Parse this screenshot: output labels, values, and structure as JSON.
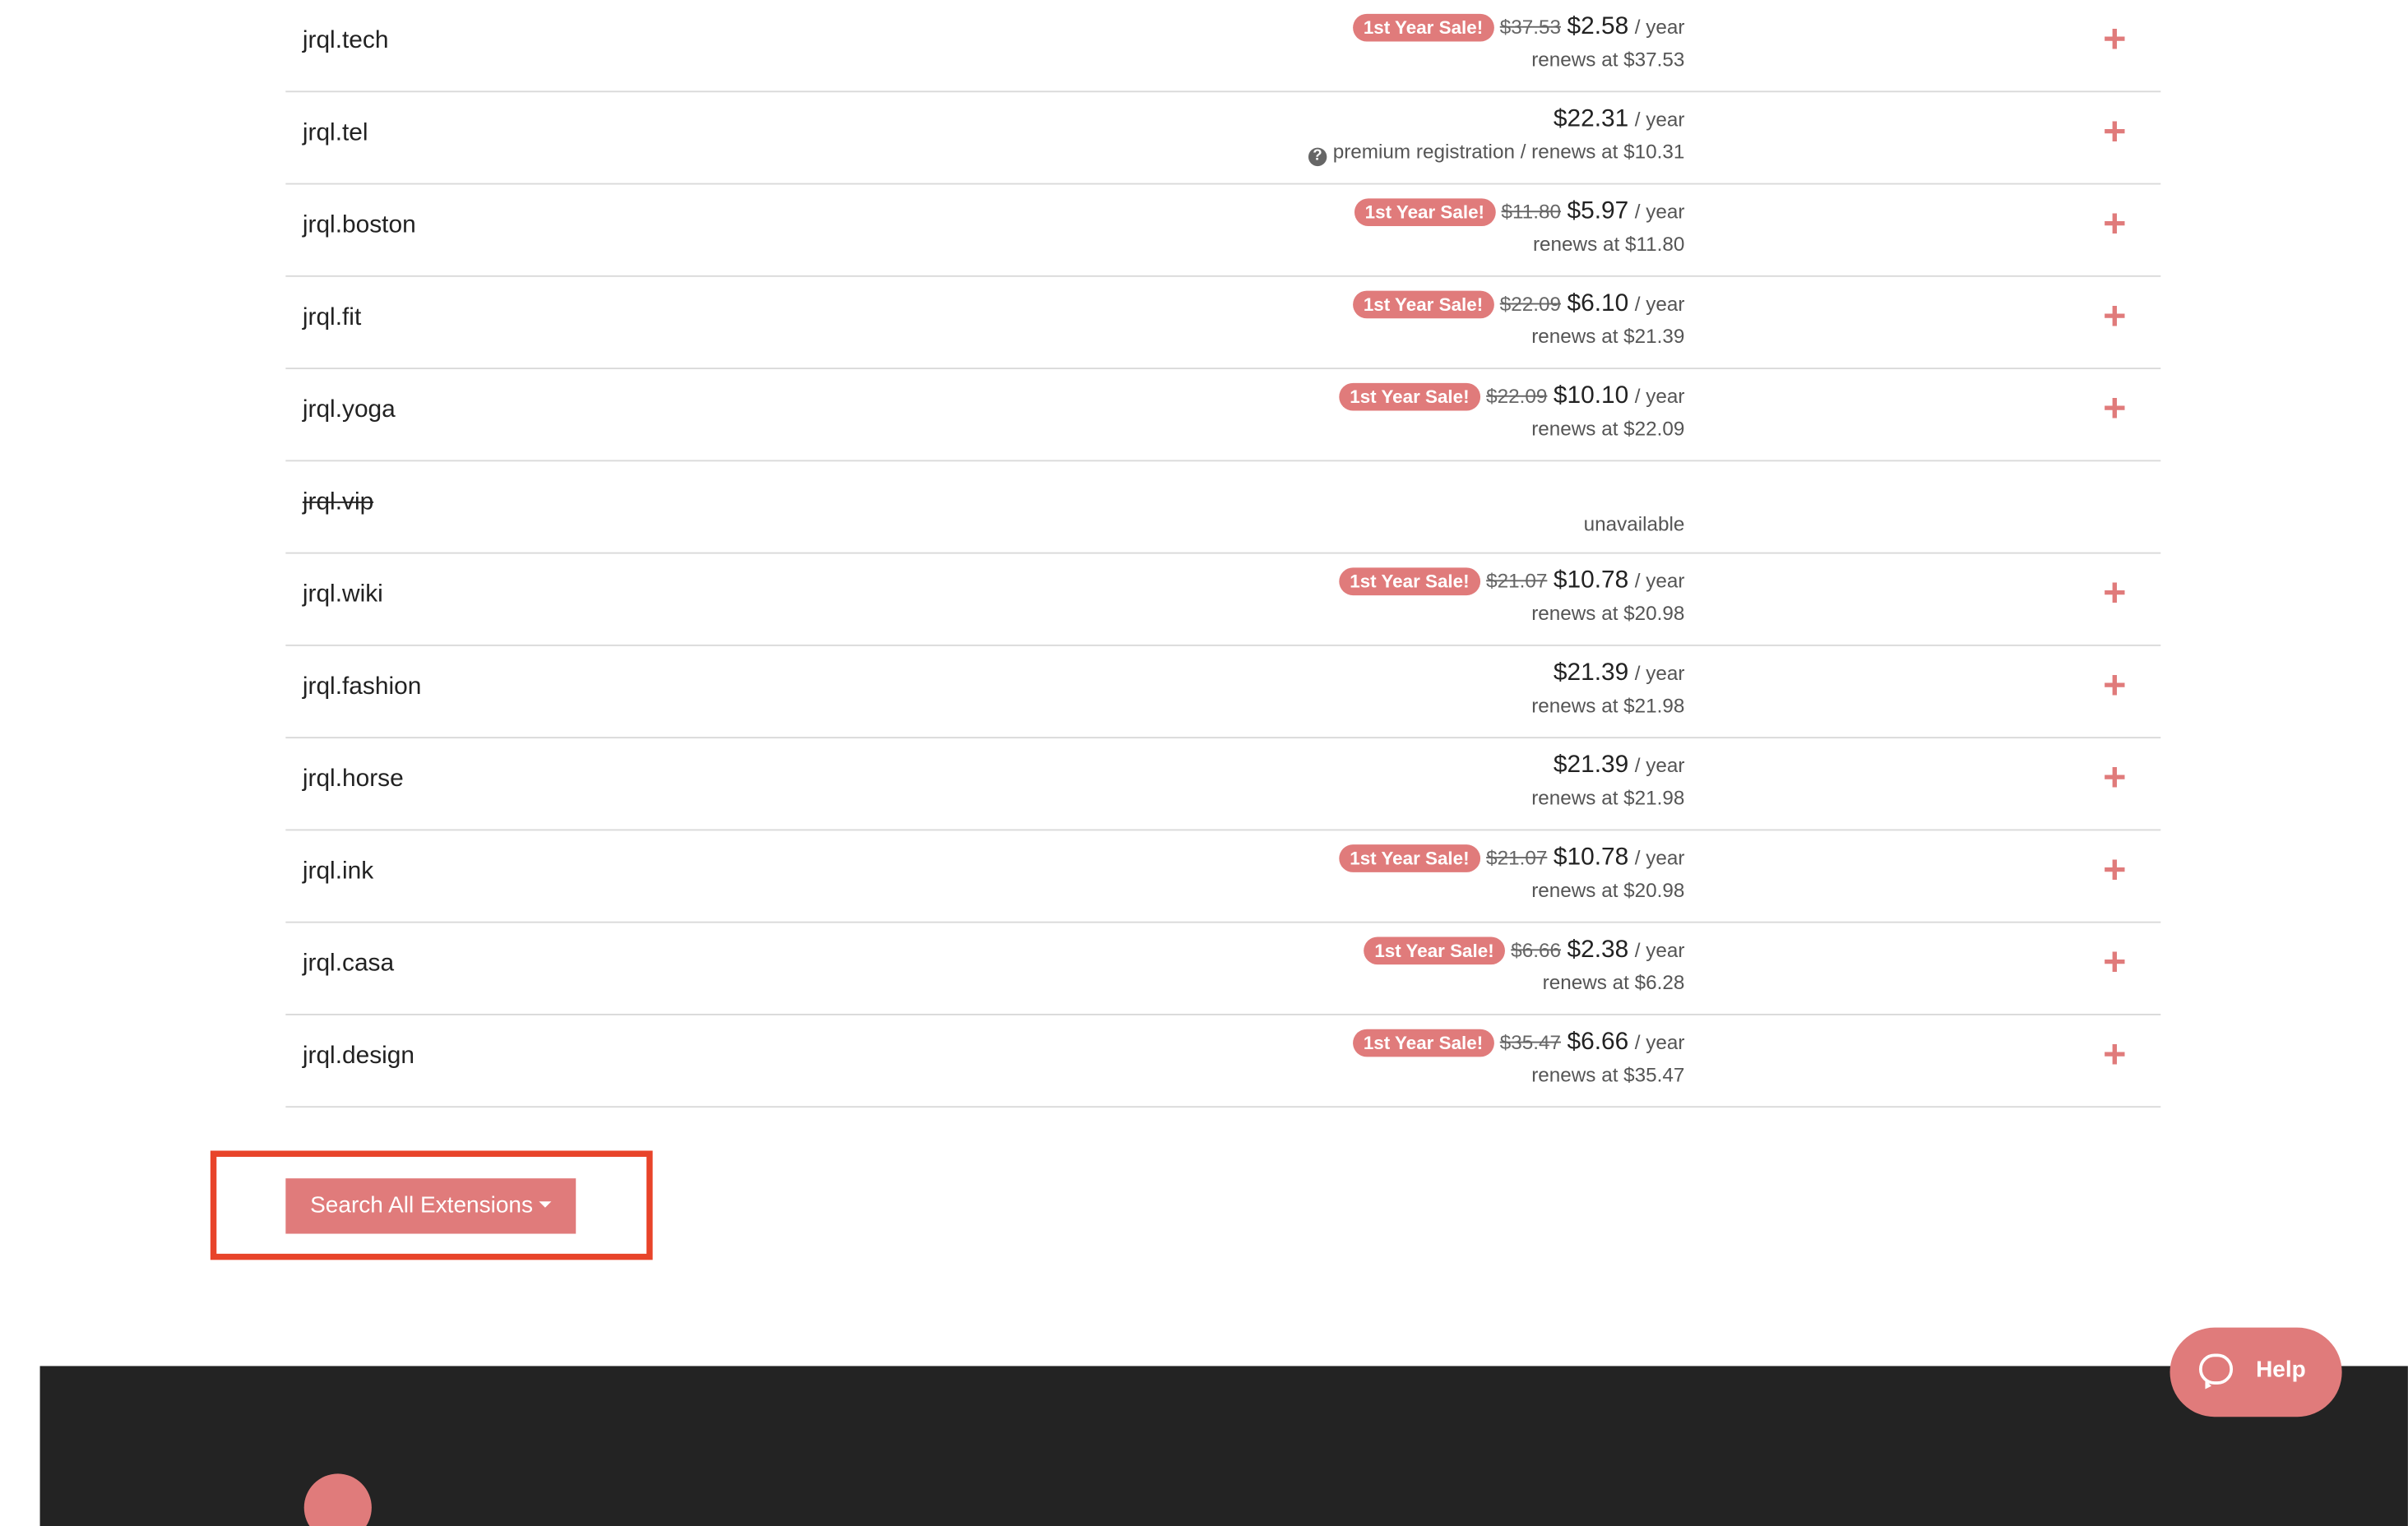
{
  "domains": [
    {
      "name": "jrql.tech",
      "badge": "1st Year Sale!",
      "old": "$37.53",
      "price": "$2.58",
      "per": "/ year",
      "sub": "renews at $37.53"
    },
    {
      "name": "jrql.tel",
      "badge": "",
      "old": "",
      "price": "$22.31",
      "per": "/ year",
      "sub": "premium registration / renews at $10.31",
      "info_icon": "question-circle-icon"
    },
    {
      "name": "jrql.boston",
      "badge": "1st Year Sale!",
      "old": "$11.80",
      "price": "$5.97",
      "per": "/ year",
      "sub": "renews at $11.80"
    },
    {
      "name": "jrql.fit",
      "badge": "1st Year Sale!",
      "old": "$22.09",
      "price": "$6.10",
      "per": "/ year",
      "sub": "renews at $21.39"
    },
    {
      "name": "jrql.yoga",
      "badge": "1st Year Sale!",
      "old": "$22.09",
      "price": "$10.10",
      "per": "/ year",
      "sub": "renews at $22.09"
    },
    {
      "name": "jrql.vip",
      "unavailable": true,
      "status": "unavailable"
    },
    {
      "name": "jrql.wiki",
      "badge": "1st Year Sale!",
      "old": "$21.07",
      "price": "$10.78",
      "per": "/ year",
      "sub": "renews at $20.98"
    },
    {
      "name": "jrql.fashion",
      "badge": "",
      "old": "",
      "price": "$21.39",
      "per": "/ year",
      "sub": "renews at $21.98"
    },
    {
      "name": "jrql.horse",
      "badge": "",
      "old": "",
      "price": "$21.39",
      "per": "/ year",
      "sub": "renews at $21.98"
    },
    {
      "name": "jrql.ink",
      "badge": "1st Year Sale!",
      "old": "$21.07",
      "price": "$10.78",
      "per": "/ year",
      "sub": "renews at $20.98"
    },
    {
      "name": "jrql.casa",
      "badge": "1st Year Sale!",
      "old": "$6.66",
      "price": "$2.38",
      "per": "/ year",
      "sub": "renews at $6.28"
    },
    {
      "name": "jrql.design",
      "badge": "1st Year Sale!",
      "old": "$35.47",
      "price": "$6.66",
      "per": "/ year",
      "sub": "renews at $35.47"
    }
  ],
  "add_icon": "plus-icon",
  "search_button": {
    "label": "Search All Extensions",
    "icon": "caret-down-icon"
  },
  "help_button": {
    "label": "Help",
    "icon": "chat-bubble-icon"
  },
  "colors": {
    "accent": "#e07b7b",
    "highlight_border": "#e8442a",
    "footer": "#232323"
  }
}
